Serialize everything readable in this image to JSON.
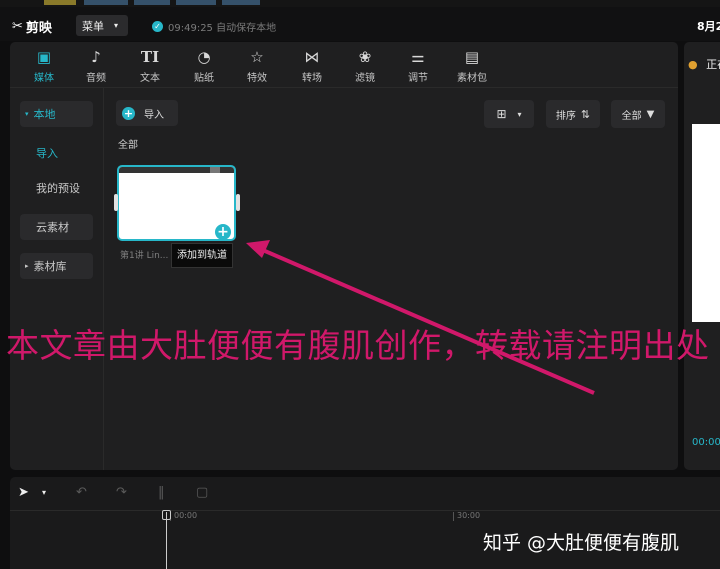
{
  "app": {
    "name": "剪映",
    "menu_label": "菜单",
    "save_status": "09:49:25 自动保存本地",
    "date_fragment": "8月2"
  },
  "tabs": [
    {
      "label": "媒体",
      "icon": "media-play-icon",
      "active": true
    },
    {
      "label": "音频",
      "icon": "audio-note-icon",
      "active": false
    },
    {
      "label": "文本",
      "icon": "text-tt-icon",
      "active": false
    },
    {
      "label": "贴纸",
      "icon": "sticker-icon",
      "active": false
    },
    {
      "label": "特效",
      "icon": "effects-star-icon",
      "active": false
    },
    {
      "label": "转场",
      "icon": "transition-bowtie-icon",
      "active": false
    },
    {
      "label": "滤镜",
      "icon": "filter-circles-icon",
      "active": false
    },
    {
      "label": "调节",
      "icon": "adjust-sliders-icon",
      "active": false
    },
    {
      "label": "素材包",
      "icon": "package-icon",
      "active": false
    }
  ],
  "sidebar": {
    "local": "本地",
    "import": "导入",
    "my_presets": "我的预设",
    "cloud": "云素材",
    "library": "素材库"
  },
  "media": {
    "import_button": "导入",
    "sort_button": "排序",
    "filter_button": "全部",
    "section_label": "全部",
    "file_name": "第1讲 Lin...",
    "tooltip": "添加到轨道"
  },
  "right_panel": {
    "title": "正在",
    "time": "00:00"
  },
  "timeline": {
    "tick0": "00:00",
    "tick1": "30:00"
  },
  "overlay": {
    "watermark": "本文章由大肚便便有腹肌创作，转载请注明出处",
    "signature": "知乎 @大肚便便有腹肌"
  },
  "colors": {
    "accent": "#27b7c9",
    "watermark": "#d0186a",
    "arrow": "#d0186a"
  }
}
